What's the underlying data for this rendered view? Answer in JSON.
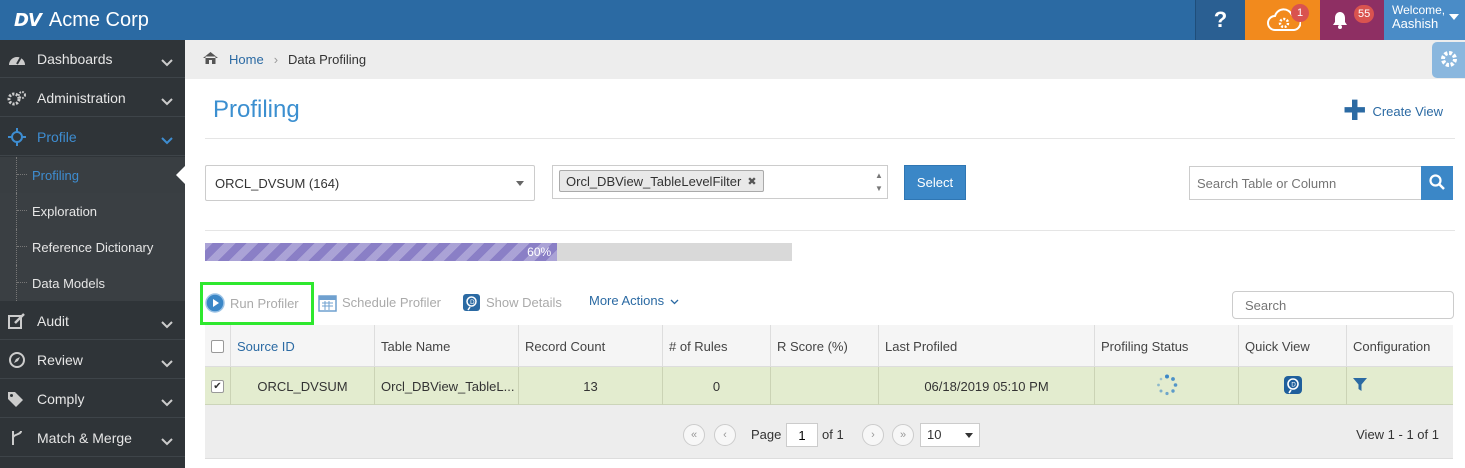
{
  "app": {
    "logo_text": "DV",
    "brand_name": "Acme Corp"
  },
  "topbar": {
    "help_label": "?",
    "cloud_badge": "1",
    "bell_badge": "55",
    "user_welcome": "Welcome,",
    "user_name": "Aashish",
    "colors": {
      "bar": "#2b6aa3",
      "cloud": "#f28a1d",
      "bell": "#8e2f63",
      "user": "#4a8cc7"
    }
  },
  "sidebar": {
    "items": [
      {
        "label": "Dashboards",
        "icon": "dashboard-icon"
      },
      {
        "label": "Administration",
        "icon": "cogs-icon"
      },
      {
        "label": "Profile",
        "icon": "crosshair-icon",
        "active": true
      },
      {
        "label": "Audit",
        "icon": "edit-icon"
      },
      {
        "label": "Review",
        "icon": "compass-icon"
      },
      {
        "label": "Comply",
        "icon": "tags-icon"
      },
      {
        "label": "Match & Merge",
        "icon": "merge-icon"
      }
    ],
    "subitems": [
      {
        "label": "Profiling",
        "active": true
      },
      {
        "label": "Exploration"
      },
      {
        "label": "Reference Dictionary"
      },
      {
        "label": "Data Models"
      }
    ]
  },
  "breadcrumb": {
    "home": "Home",
    "current": "Data Profiling"
  },
  "page": {
    "title": "Profiling",
    "create_view": "Create View"
  },
  "filters": {
    "datasource": "ORCL_DVSUM (164)",
    "filter_tag": "Orcl_DBView_TableLevelFilter",
    "select_button": "Select",
    "search_placeholder": "Search Table or Column"
  },
  "progress": {
    "value": 0.6,
    "label": "60%"
  },
  "actions": {
    "run_profiler": "Run Profiler",
    "schedule_profiler": "Schedule Profiler",
    "show_details": "Show Details",
    "more_actions": "More Actions",
    "grid_search_placeholder": "Search"
  },
  "table": {
    "columns": [
      "Source ID",
      "Table Name",
      "Record Count",
      "# of Rules",
      "R Score (%)",
      "Last Profiled",
      "Profiling Status",
      "Quick View",
      "Configuration"
    ],
    "rows": [
      {
        "checked": true,
        "source_id": "ORCL_DVSUM",
        "table_name": "Orcl_DBView_TableL...",
        "record_count": "13",
        "rules": "0",
        "r_score": "",
        "last_profiled": "06/18/2019 05:10 PM"
      }
    ]
  },
  "pager": {
    "page_label": "Page",
    "page_value": "1",
    "of_label": "of 1",
    "page_size": "10",
    "view_info": "View 1 - 1 of 1"
  }
}
